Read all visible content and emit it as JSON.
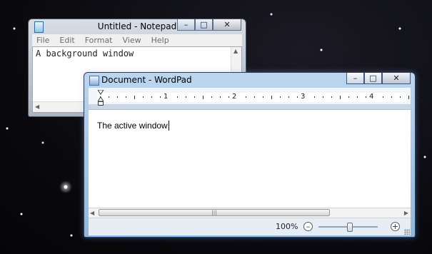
{
  "notepad": {
    "title": "Untitled - Notepad",
    "menu": [
      "File",
      "Edit",
      "Format",
      "View",
      "Help"
    ],
    "content": "A background window",
    "controls": {
      "minimize": "–",
      "maximize": "□",
      "close": "✕"
    }
  },
  "wordpad": {
    "title": "Document - WordPad",
    "ruler_numbers": [
      "1",
      "2",
      "3",
      "4"
    ],
    "content": "The active window",
    "scroll_thumb_grip": "|||",
    "zoom": {
      "label": "100%",
      "minus": "–",
      "plus": "+",
      "level": 0.5
    },
    "controls": {
      "minimize": "–",
      "maximize": "□",
      "close": "✕"
    }
  },
  "colors": {
    "active_frame": "#90b7dd",
    "inactive_frame": "#aab4c0"
  }
}
